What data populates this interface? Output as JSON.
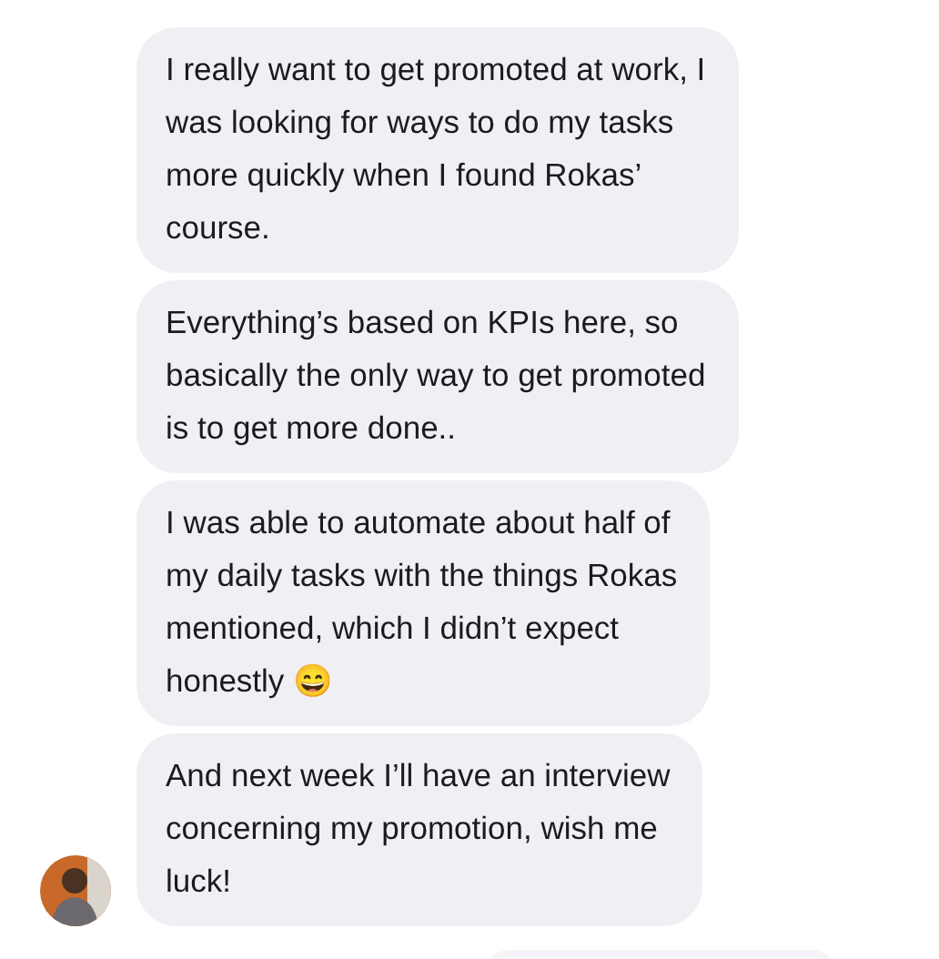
{
  "messages": [
    {
      "text": "I really want to get promoted at work, I\nwas looking for ways to do my tasks\nmore quickly when I found Rokas’\ncourse.",
      "avatar": false
    },
    {
      "text": "Everything’s based on KPIs here, so\nbasically the only way to get promoted\nis to get more done..",
      "avatar": false
    },
    {
      "text": "I was able to automate about half of\nmy daily tasks with the things Rokas\nmentioned, which I didn’t expect\nhonestly 😄",
      "avatar": false
    },
    {
      "text": "And next week I’ll have an interview\nconcerning my promotion, wish me\nluck!",
      "avatar": true
    }
  ]
}
